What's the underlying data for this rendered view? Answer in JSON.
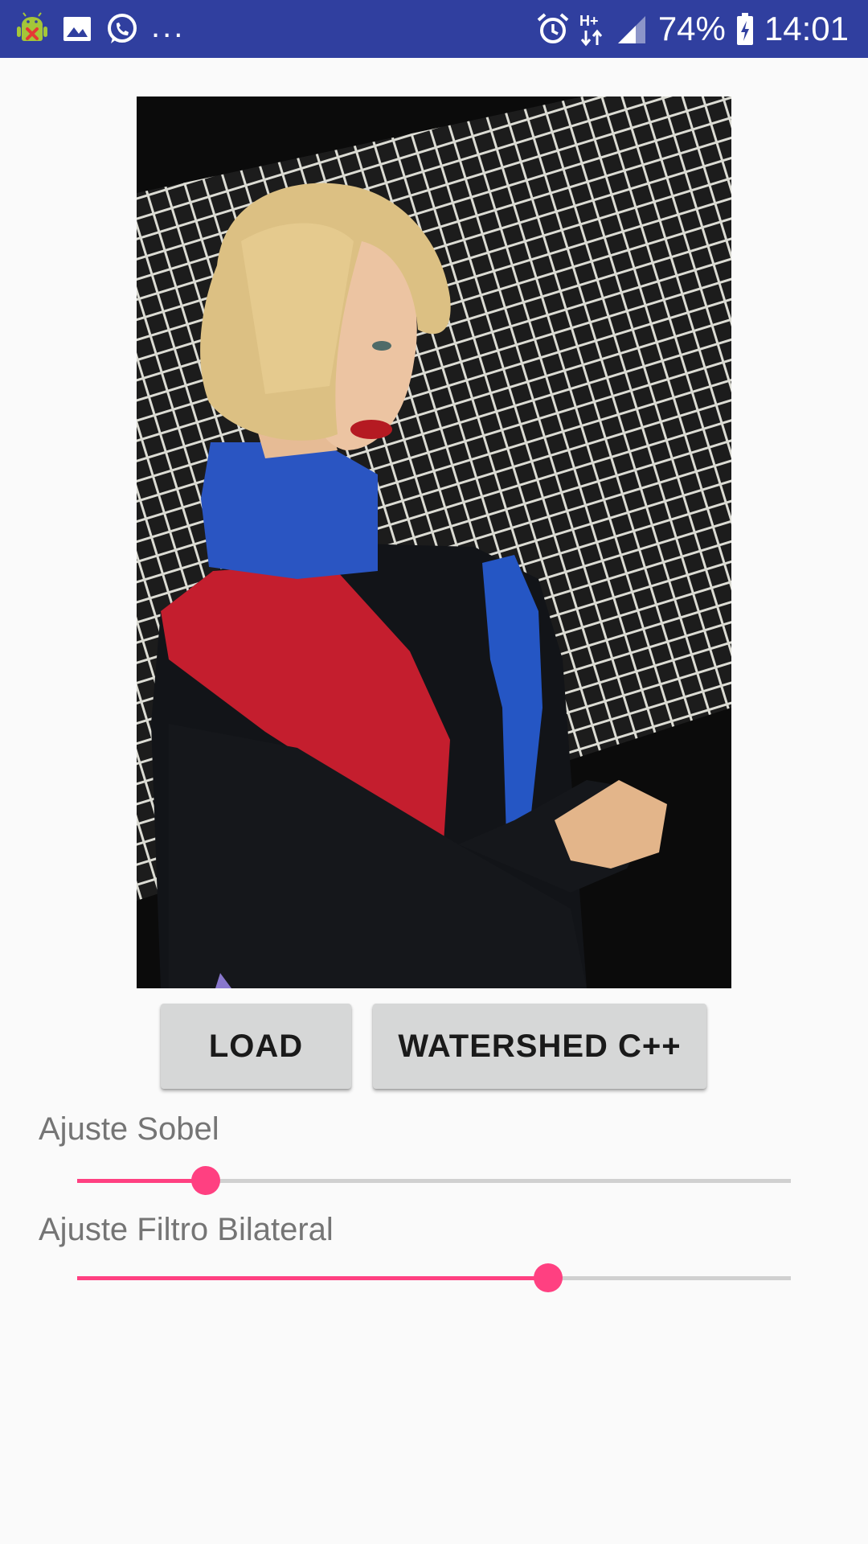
{
  "status_bar": {
    "background": "#303f9f",
    "left_icons": [
      "android-debug-icon",
      "gallery-icon",
      "whatsapp-icon"
    ],
    "more_indicator": "...",
    "right_icons": [
      "alarm-icon",
      "network-hplus-icon",
      "signal-icon"
    ],
    "battery_percent": "74%",
    "battery_icon": "battery-charging-icon",
    "time": "14:01"
  },
  "main": {
    "image": {
      "description_icon": "photo-preview"
    },
    "buttons": {
      "load_label": "LOAD",
      "watershed_label": "WATERSHED C++"
    },
    "sliders": [
      {
        "label": "Ajuste Sobel",
        "value_fraction": 0.18
      },
      {
        "label": "Ajuste Filtro Bilateral",
        "value_fraction": 0.66
      }
    ],
    "accent_color": "#ff4081",
    "button_color": "#d6d7d7"
  }
}
